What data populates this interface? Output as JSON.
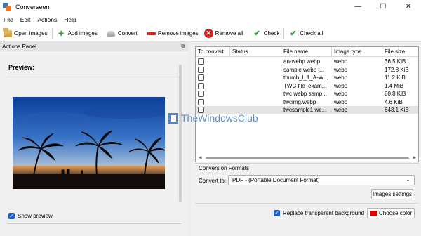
{
  "window": {
    "title": "Converseen",
    "controls": [
      "—",
      "☐",
      "✕"
    ]
  },
  "menu": [
    "File",
    "Edit",
    "Actions",
    "Help"
  ],
  "toolbar": {
    "open_images": "Open images",
    "add_images": "Add images",
    "convert": "Convert",
    "remove_images": "Remove images",
    "remove_all": "Remove all",
    "check": "Check",
    "check_all": "Check all"
  },
  "actions_panel": {
    "title": "Actions Panel",
    "undock": "⧉",
    "preview_label": "Preview:",
    "show_preview": "Show preview",
    "show_preview_checked": true
  },
  "table": {
    "headers": [
      "To convert",
      "Status",
      "File name",
      "Image type",
      "File size"
    ],
    "rows": [
      {
        "file": "an-webp.webp",
        "type": "webp",
        "size": "36.5 KiB",
        "selected": false
      },
      {
        "file": "sample webp t...",
        "type": "webp",
        "size": "172.8 KiB",
        "selected": false
      },
      {
        "file": "thumb_l_1_A-W...",
        "type": "webp",
        "size": "11.2 KiB",
        "selected": false
      },
      {
        "file": "TWC file_exam...",
        "type": "webp",
        "size": "1.4 MiB",
        "selected": false
      },
      {
        "file": "twc webp samp...",
        "type": "webp",
        "size": "80.8 KiB",
        "selected": false
      },
      {
        "file": "twcimg.webp",
        "type": "webp",
        "size": "4.6 KiB",
        "selected": false
      },
      {
        "file": "twcsample1.we...",
        "type": "webp",
        "size": "643.1 KiB",
        "selected": true
      }
    ]
  },
  "conversion": {
    "section_title": "Conversion Formats",
    "convert_to_label": "Convert to:",
    "convert_to_value": "PDF - (Portable Document Format)",
    "images_settings": "Images settings",
    "replace_transparent": "Replace transparent background",
    "replace_checked": true,
    "choose_color": "Choose color",
    "color": "#e00000"
  },
  "watermark": {
    "text": "TheWindowsClub"
  }
}
